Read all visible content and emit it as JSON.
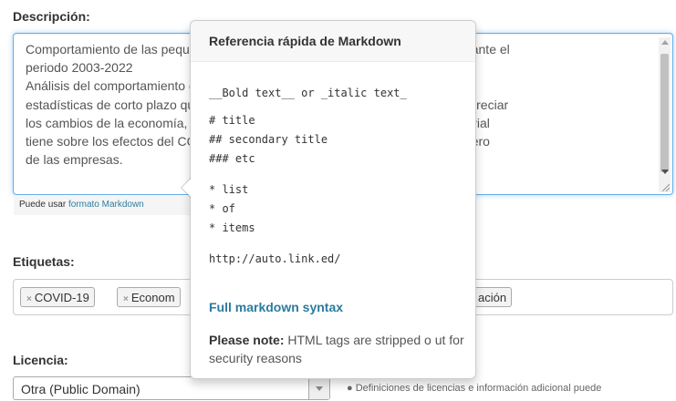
{
  "description": {
    "label": "Descripción:",
    "text": "Comportamiento de las pequeñas y medianas empresas de Quintana Roo, durante el\nperiodo 2003-2022\nAnálisis del comportamiento de las empresas, considerando las\nestadísticas de corto plazo que permitan mostrar variables que nos permitan apreciar\nlos cambios de la economía, la incidencia de los cambios en el sector empresarial\ntiene sobre los efectos del COVID-19 sobre el desempeño económico y financiero\nde las empresas.",
    "help_text": "Puede usar ",
    "help_link": "formato Markdown"
  },
  "markdown_popover": {
    "title": "Referencia rápida de Markdown",
    "bold_italic": "__Bold text__ or _italic text_",
    "h1": "# title",
    "h2": "## secondary title",
    "h3": "### etc",
    "list1": "* list",
    "list2": "* of",
    "list3": "* items",
    "autolink": "http://auto.link.ed/",
    "full_syntax_link": "Full markdown syntax",
    "note_bold": "Please note:",
    "note_text": " HTML tags are stripped o ut for security reasons"
  },
  "tags": {
    "label": "Etiquetas:",
    "items": [
      "COVID-19",
      "Econom",
      "ación"
    ],
    "remove_glyph": "×"
  },
  "license": {
    "label": "Licencia:",
    "selected": "Otra (Public Domain)",
    "note": "Definiciones de licencias e información adicional puede"
  }
}
